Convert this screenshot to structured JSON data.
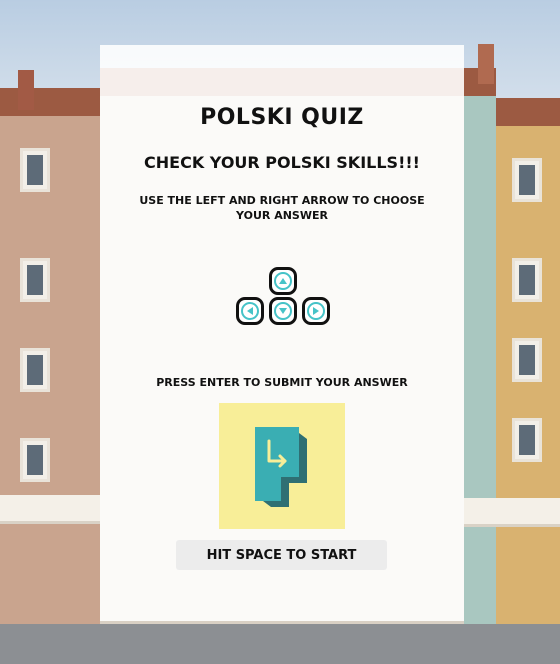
{
  "quiz": {
    "title": "POLSKI QUIZ",
    "subtitle": "CHECK YOUR POLSKI SKILLS!!!",
    "instructions": "USE THE LEFT AND RIGHT ARROW TO CHOOSE YOUR ANSWER",
    "enter_instruction": "PRESS ENTER TO SUBMIT YOUR ANSWER",
    "start_button_label": "HIT SPACE TO START"
  },
  "icons": {
    "arrow_keys": "arrow-keys-icon",
    "enter_key": "enter-key-icon"
  },
  "colors": {
    "accent_teal": "#46c3c8",
    "enter_key_bg": "#f8ee98",
    "panel_bg": "#ffffff"
  }
}
